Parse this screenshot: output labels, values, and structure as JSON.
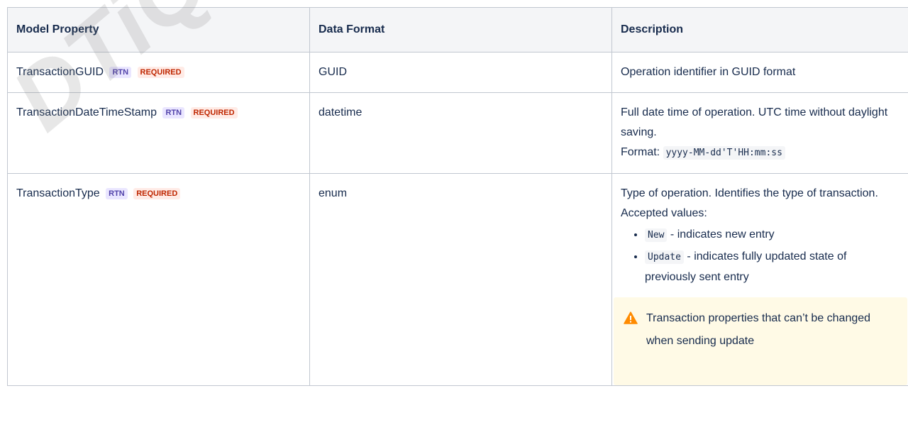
{
  "table": {
    "headers": [
      "Model Property",
      "Data Format",
      "Description"
    ],
    "badges": {
      "rtn": "RTN",
      "required": "REQUIRED"
    },
    "rows": [
      {
        "property": "TransactionGUID",
        "format": "GUID",
        "description": "Operation identifier in GUID format"
      },
      {
        "property": "TransactionDateTimeStamp",
        "format": "datetime",
        "description": "Full date time of operation. UTC time without daylight saving.",
        "format_label": "Format:",
        "format_code": "yyyy-MM-dd'T'HH:mm:ss"
      },
      {
        "property": "TransactionType",
        "format": "enum",
        "description": "Type of operation. Identifies the type of transaction. Accepted values:",
        "values": [
          {
            "code": "New",
            "text": " - indicates new entry"
          },
          {
            "code": "Update",
            "text": " - indicates fully updated state of previously sent entry"
          }
        ],
        "note": "Transaction properties that can’t be changed when sending update"
      }
    ]
  },
  "watermark": "DTiQ Proprietary",
  "colors": {
    "rtn_bg": "#eae6ff",
    "rtn_text": "#5243aa",
    "required_bg": "#ffebe6",
    "required_text": "#bf2600",
    "note_bg": "#fffae6",
    "warning_icon": "#ff8b00"
  },
  "icons": {
    "note": "warning-icon"
  }
}
